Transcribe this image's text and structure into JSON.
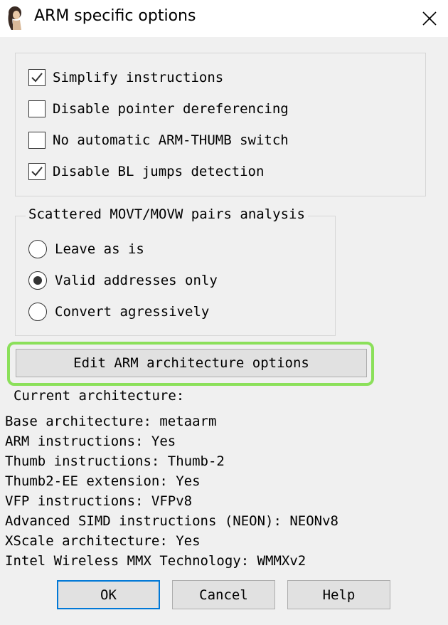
{
  "window": {
    "title": "ARM specific options",
    "icon": "app-figure-icon",
    "close_icon": "close-icon"
  },
  "options": [
    {
      "label": "Simplify instructions",
      "checked": true
    },
    {
      "label": "Disable pointer dereferencing",
      "checked": false
    },
    {
      "label": "No automatic ARM-THUMB switch",
      "checked": false
    },
    {
      "label": "Disable BL jumps detection",
      "checked": true
    }
  ],
  "movt_group": {
    "title": "Scattered MOVT/MOVW pairs analysis",
    "radios": [
      {
        "label": "Leave as is",
        "selected": false
      },
      {
        "label": "Valid addresses only",
        "selected": true
      },
      {
        "label": "Convert agressively",
        "selected": false
      }
    ]
  },
  "edit_button": "Edit ARM architecture options",
  "architecture": {
    "heading": "Current architecture:",
    "lines": [
      "Base architecture: metaarm",
      "ARM instructions: Yes",
      "Thumb instructions: Thumb-2",
      "Thumb2-EE extension: Yes",
      "VFP instructions: VFPv8",
      "Advanced SIMD instructions (NEON): NEONv8",
      "XScale architecture: Yes",
      "Intel Wireless MMX Technology: WMMXv2"
    ]
  },
  "buttons": {
    "ok": "OK",
    "cancel": "Cancel",
    "help": "Help"
  },
  "colors": {
    "highlight": "#8be05a",
    "default_button_border": "#0078d7"
  }
}
